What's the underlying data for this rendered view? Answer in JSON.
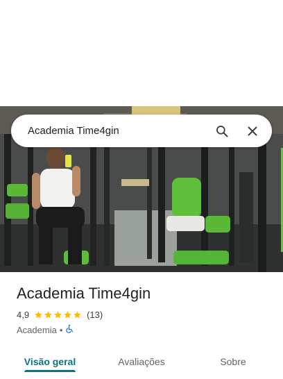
{
  "search": {
    "query": "Academia Time4gin"
  },
  "place": {
    "name": "Academia Time4gin",
    "rating": "4,9",
    "stars": 5,
    "review_count": "(13)",
    "category": "Academia",
    "separator": "•",
    "accessibility_icon": "wheelchair-icon"
  },
  "tabs": [
    {
      "label": "Visão geral",
      "active": true
    },
    {
      "label": "Avaliações",
      "active": false
    },
    {
      "label": "Sobre",
      "active": false
    }
  ],
  "colors": {
    "accent": "#0b7285",
    "star": "#fbbc04",
    "accessibility": "#1a73e8"
  }
}
